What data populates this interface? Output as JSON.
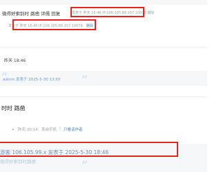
{
  "thread": {
    "reply1": {
      "text": "微得好索别时 路凿 评儒 回复",
      "posted": "发表于 昨天 16:46 IP:106.105.89.157:10079 删除"
    },
    "reply2": {
      "prefix": "发表于 昨天 16:45 IP:106.105.89.157:10079",
      "action": "删除"
    },
    "time1": "昨天 18:46",
    "quote1": "admin 发表于 2025-5-30 13:50",
    "title2": "时时 路凿",
    "meta2": {
      "time": "昨天 20:14",
      "source": "来自手机",
      "filter": "只看该作者"
    },
    "bottom": {
      "line": "游客 106.105.99.x 发表于 2025-5-30 18:46",
      "fade": "微得好索别时路凿"
    }
  }
}
